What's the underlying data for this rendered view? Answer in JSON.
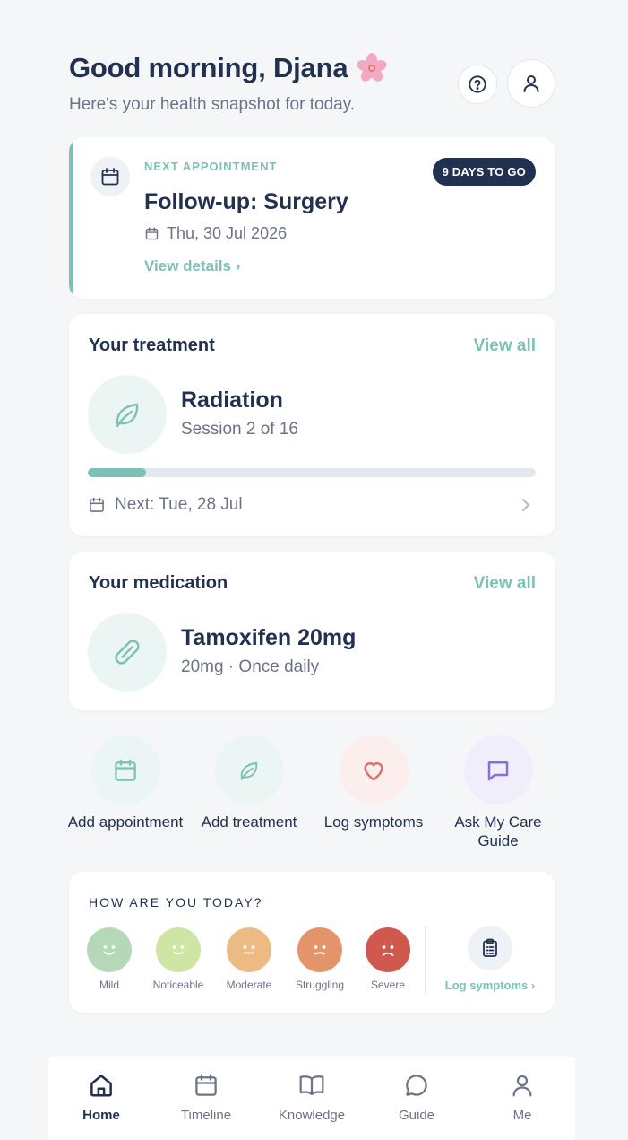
{
  "header": {
    "greeting": "Good morning, Djana",
    "greeting_emoji_icon": "cherry-blossom-icon",
    "subtitle": "Here's your health snapshot for today.",
    "help_icon": "question-circle-icon",
    "profile_icon": "user-icon"
  },
  "appointment": {
    "label": "NEXT APPOINTMENT",
    "badge": "9 DAYS TO GO",
    "title": "Follow-up: Surgery",
    "date": "Thu, 30 Jul 2026",
    "link": "View details ›",
    "icon": "calendar-icon"
  },
  "treatment": {
    "title": "Your treatment",
    "view_all": "View all",
    "name": "Radiation",
    "session": "Session 2 of 16",
    "progress_fraction": 0.13,
    "next": "Next: Tue, 28 Jul",
    "icon": "leaf-icon"
  },
  "medication": {
    "title": "Your medication",
    "view_all": "View all",
    "name": "Tamoxifen 20mg",
    "dosage": "20mg · Once daily",
    "icon": "pill-icon"
  },
  "quick_actions": [
    {
      "label": "Add appointment",
      "icon": "calendar-icon"
    },
    {
      "label": "Add treatment",
      "icon": "leaf-icon"
    },
    {
      "label": "Log symptoms",
      "icon": "heart-icon"
    },
    {
      "label": "Ask My Care Guide",
      "icon": "chat-bubble-icon"
    }
  ],
  "mood": {
    "question": "HOW ARE YOU TODAY?",
    "options": [
      {
        "label": "Mild",
        "color": "#b5d8b9"
      },
      {
        "label": "Noticeable",
        "color": "#cfe5a4"
      },
      {
        "label": "Moderate",
        "color": "#ecbb84"
      },
      {
        "label": "Struggling",
        "color": "#e4946b"
      },
      {
        "label": "Severe",
        "color": "#d1584f"
      }
    ],
    "log_label": "Log symptoms ›",
    "log_icon": "clipboard-icon"
  },
  "tabs": [
    {
      "label": "Home",
      "icon": "home-icon",
      "active": true
    },
    {
      "label": "Timeline",
      "icon": "calendar-icon",
      "active": false
    },
    {
      "label": "Knowledge",
      "icon": "book-icon",
      "active": false
    },
    {
      "label": "Guide",
      "icon": "chat-bubble-icon",
      "active": false
    },
    {
      "label": "Me",
      "icon": "user-icon",
      "active": false
    }
  ],
  "colors": {
    "accent": "#7cc2b4",
    "navy": "#22314f",
    "muted": "#6b7384",
    "background": "#f5f6f8"
  }
}
